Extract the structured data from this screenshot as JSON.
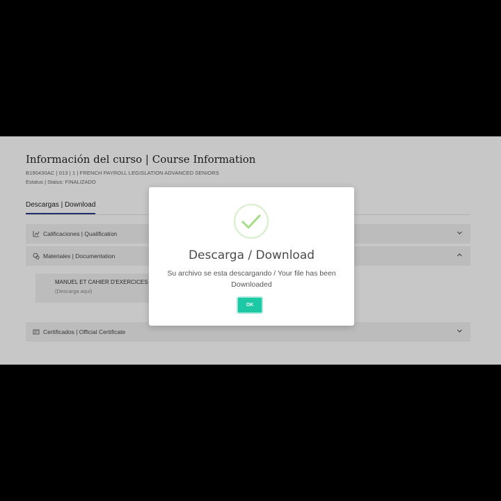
{
  "page": {
    "title": "Información del curso | Course Information",
    "course_line": "B190430AC | 013 | 1 | FRENCH PAYROLL LEGISLATION ADVANCED SENIORS",
    "status_line": "Estatus | Status: FINALIZADO"
  },
  "tabs": [
    {
      "label": "Descargas | Download",
      "active": true
    }
  ],
  "sections": [
    {
      "label": "Calificaciones | Qualification",
      "icon": "chart-icon",
      "expanded": false
    },
    {
      "label": "Materiales | Documentation",
      "icon": "materials-icon",
      "expanded": true
    },
    {
      "label": "Certificados | Official Certificate",
      "icon": "certificate-icon",
      "expanded": false
    }
  ],
  "material": {
    "name": "MANUEL ET CAHIER D'EXERCICES",
    "hint": "(Descarga aqui)"
  },
  "modal": {
    "icon": "check-circle-icon",
    "title": "Descarga / Download",
    "message": "Su archivo se esta descargando / Your file has been Downloaded",
    "ok_label": "OK"
  },
  "colors": {
    "accent": "#1dc9a5",
    "success": "#a5dc86",
    "tab_underline": "#2a3a8a"
  }
}
